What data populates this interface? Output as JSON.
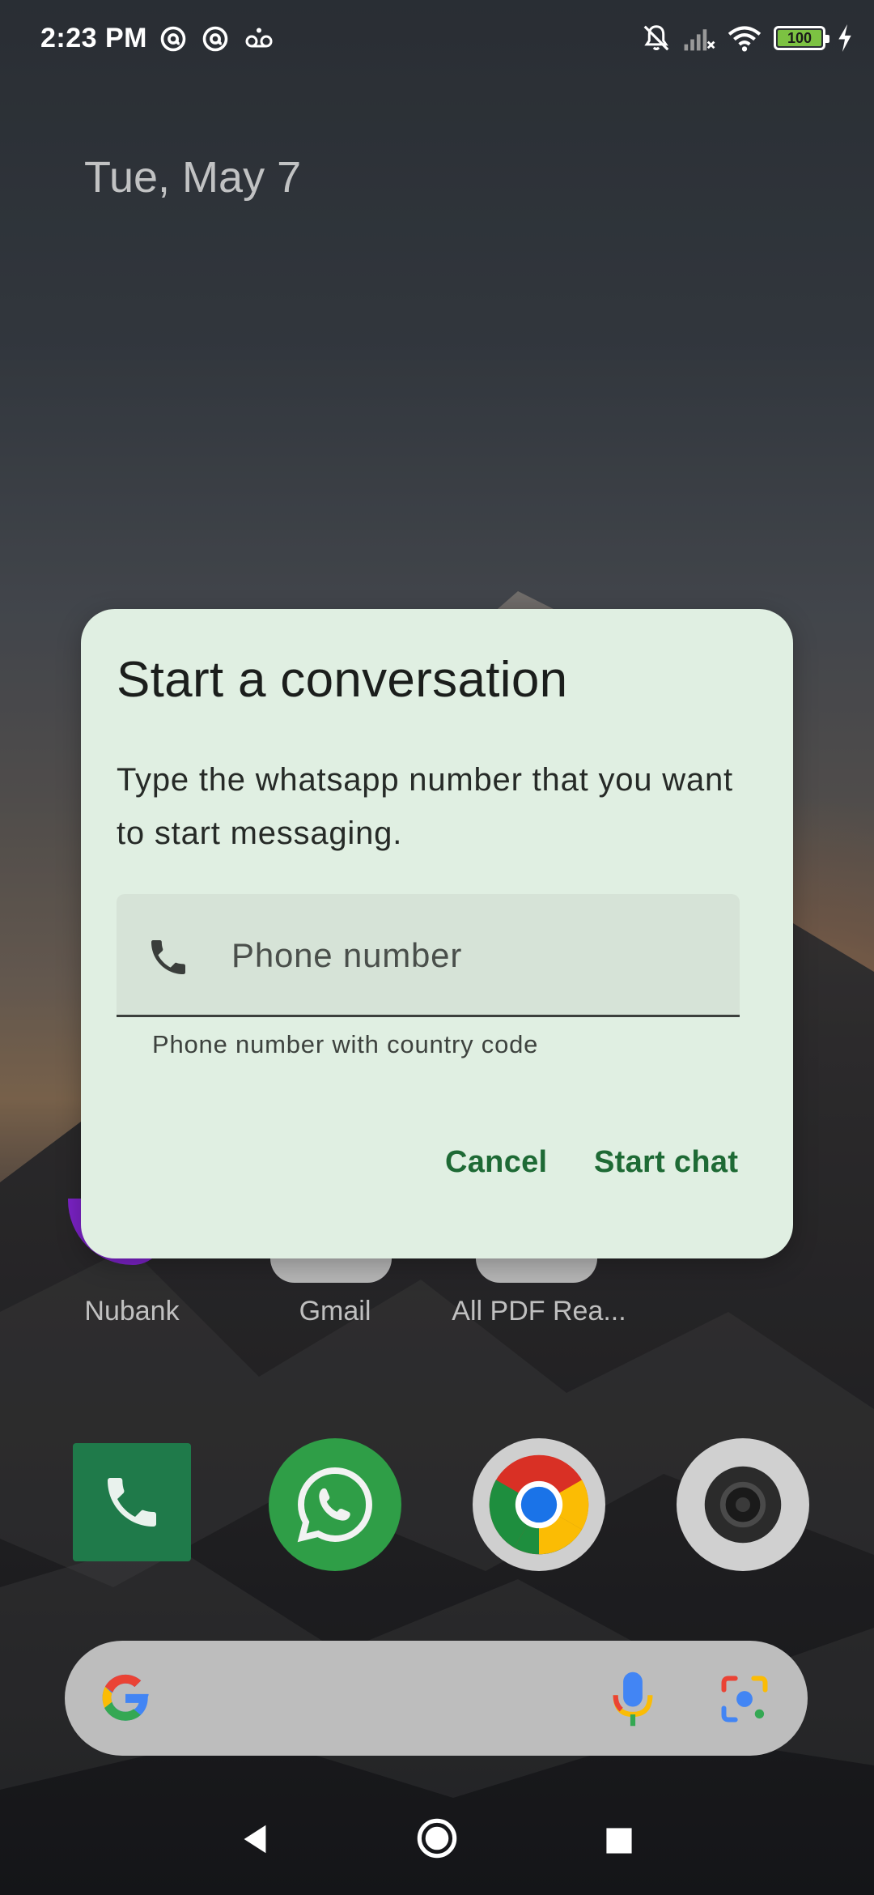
{
  "status_bar": {
    "time": "2:23 PM",
    "left_icons": [
      "at-sign-icon",
      "at-sign-icon",
      "voicemail-icon"
    ],
    "right_icons": [
      "bell-off-icon",
      "signal-off-icon",
      "wifi-icon",
      "battery-icon",
      "charging-icon"
    ],
    "battery_level": "100",
    "battery_color": "#7cc242"
  },
  "home": {
    "date": "Tue, May 7",
    "apps": [
      {
        "label": "Nubank"
      },
      {
        "label": "Gmail"
      },
      {
        "label": "All PDF Rea..."
      }
    ],
    "dock": [
      "phone-icon",
      "whatsapp-icon",
      "chrome-icon",
      "camera-icon"
    ]
  },
  "search_bar": {
    "icons": [
      "google-logo-icon",
      "microphone-icon",
      "google-lens-icon"
    ]
  },
  "nav_bar": {
    "icons": [
      "back-icon",
      "home-icon",
      "recents-icon"
    ]
  },
  "dialog": {
    "title": "Start a conversation",
    "body": "Type the whatsapp number that you want to start messaging.",
    "input": {
      "placeholder": "Phone number",
      "value": "",
      "icon": "phone-icon",
      "helper": "Phone number with country code"
    },
    "cancel_label": "Cancel",
    "confirm_label": "Start chat",
    "accent_color": "#1e6a35",
    "background_color": "#e0efe2"
  }
}
